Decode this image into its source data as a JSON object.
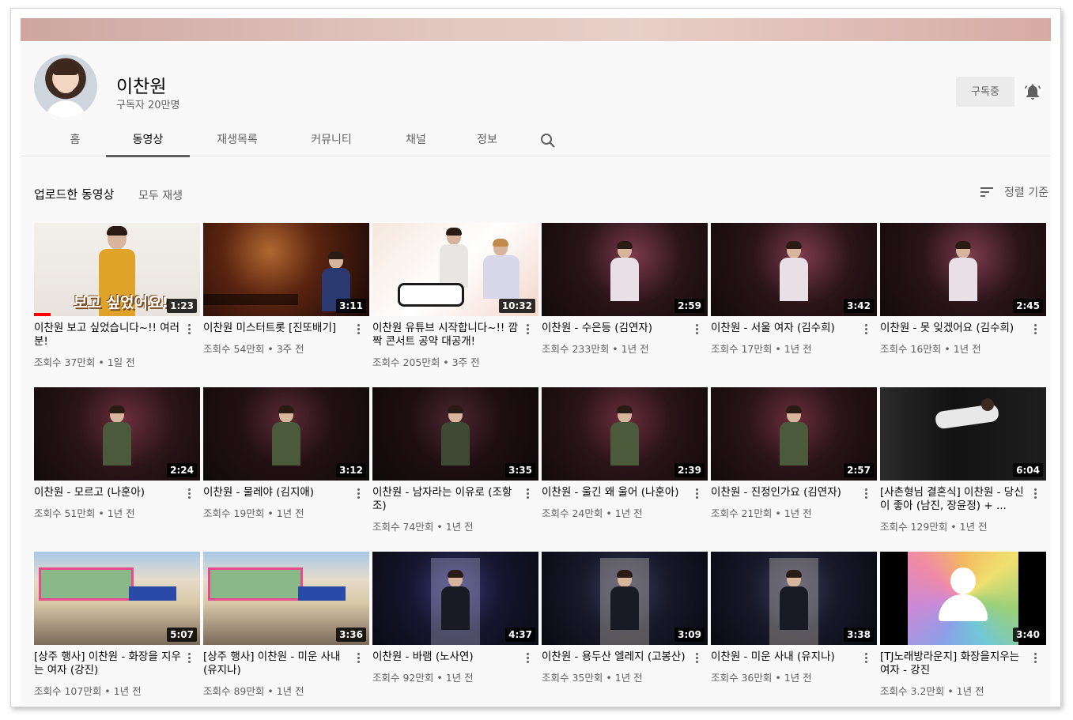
{
  "channel": {
    "name": "이찬원",
    "subscribers": "구독자 20만명"
  },
  "subscribe_label": "구독중",
  "tabs": [
    "홈",
    "동영상",
    "재생목록",
    "커뮤니티",
    "채널",
    "정보"
  ],
  "section": {
    "title": "업로드한 동영상",
    "play_all": "모두 재생",
    "sort": "정렬 기준"
  },
  "videos": [
    {
      "title": "이찬원 보고 싶었습니다~!! 여러분!",
      "views": "조회수 37만회 • 1일 전",
      "duration": "1:23",
      "overlay": "보고 싶었어요!"
    },
    {
      "title": "이찬원 미스터트롯 [진또배기]",
      "views": "조회수 54만회 • 3주 전",
      "duration": "3:11"
    },
    {
      "title": "이찬원 유튜브 시작합니다~!! 깜짝 콘서트 공약 대공개!",
      "views": "조회수 205만회 • 3주 전",
      "duration": "10:32"
    },
    {
      "title": "이찬원 - 수은등 (김연자)",
      "views": "조회수 233만회 • 1년 전",
      "duration": "2:59"
    },
    {
      "title": "이찬원 - 서울 여자 (김수희)",
      "views": "조회수 17만회 • 1년 전",
      "duration": "3:42"
    },
    {
      "title": "이찬원 - 못 잊겠어요 (김수희)",
      "views": "조회수 16만회 • 1년 전",
      "duration": "2:45"
    },
    {
      "title": "이찬원 - 모르고 (나훈아)",
      "views": "조회수 51만회 • 1년 전",
      "duration": "2:24"
    },
    {
      "title": "이찬원 - 물레야 (김지애)",
      "views": "조회수 19만회 • 1년 전",
      "duration": "3:12"
    },
    {
      "title": "이찬원 - 남자라는 이유로 (조항조)",
      "views": "조회수 74만회 • 1년 전",
      "duration": "3:35"
    },
    {
      "title": "이찬원 - 울긴 왜 울어 (나훈아)",
      "views": "조회수 24만회 • 1년 전",
      "duration": "2:39"
    },
    {
      "title": "이찬원 - 진정인가요 (김연자)",
      "views": "조회수 21만회 • 1년 전",
      "duration": "2:57"
    },
    {
      "title": "[사촌형님 결혼식] 이찬원 - 당신이 좋아 (남진, 장윤정) + ...",
      "views": "조회수 129만회 • 1년 전",
      "duration": "6:04"
    },
    {
      "title": "[상주 행사] 이찬원 - 화장을 지우는 여자 (강진)",
      "views": "조회수 107만회 • 1년 전",
      "duration": "5:07"
    },
    {
      "title": "[상주 행사] 이찬원 - 미운 사내 (유지나)",
      "views": "조회수 89만회 • 1년 전",
      "duration": "3:36"
    },
    {
      "title": "이찬원 - 바램 (노사연)",
      "views": "조회수 92만회 • 1년 전",
      "duration": "4:37"
    },
    {
      "title": "이찬원 - 용두산 엘레지 (고봉산)",
      "views": "조회수 35만회 • 1년 전",
      "duration": "3:09"
    },
    {
      "title": "이찬원 - 미운 사내 (유지나)",
      "views": "조회수 36만회 • 1년 전",
      "duration": "3:38"
    },
    {
      "title": "[TJ노래방라운지] 화장을지우는여자 - 강진",
      "views": "조회수 3.2만회 • 1년 전",
      "duration": "3:40"
    }
  ]
}
